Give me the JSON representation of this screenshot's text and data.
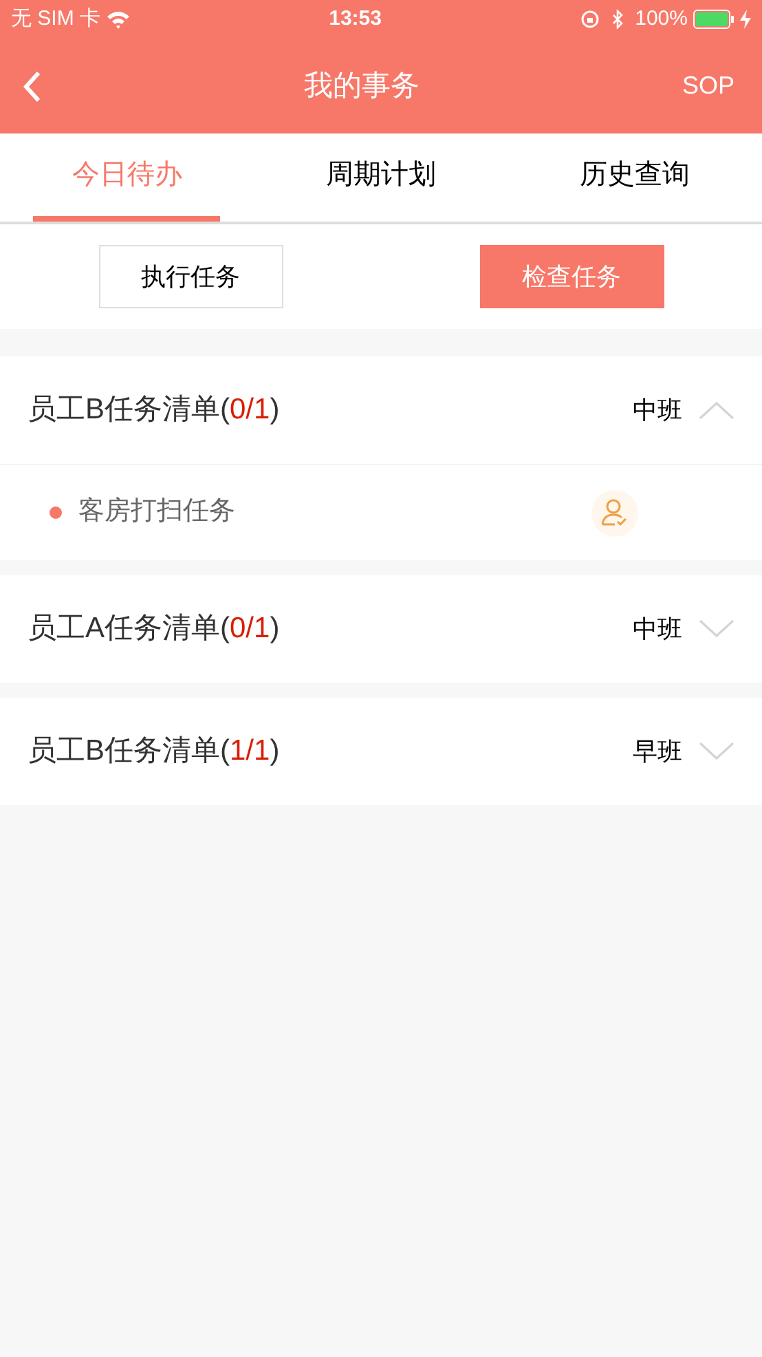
{
  "status_bar": {
    "carrier": "无 SIM 卡",
    "time": "13:53",
    "battery": "100%"
  },
  "header": {
    "title": "我的事务",
    "action": "SOP"
  },
  "tabs": [
    {
      "label": "今日待办",
      "selected": true
    },
    {
      "label": "周期计划",
      "selected": false
    },
    {
      "label": "历史查询",
      "selected": false
    }
  ],
  "mode_buttons": [
    {
      "label": "执行任务",
      "selected": false
    },
    {
      "label": "检查任务",
      "selected": true
    }
  ],
  "groups": [
    {
      "title_prefix": "员工B任务清单(",
      "count": "0/1",
      "title_suffix": ")",
      "shift": "中班",
      "expanded": true,
      "tasks": [
        {
          "name": "客房打扫任务"
        }
      ]
    },
    {
      "title_prefix": "员工A任务清单(",
      "count": "0/1",
      "title_suffix": ")",
      "shift": "中班",
      "expanded": false
    },
    {
      "title_prefix": "员工B任务清单(",
      "count": "1/1",
      "title_suffix": ")",
      "shift": "早班",
      "expanded": false
    }
  ]
}
